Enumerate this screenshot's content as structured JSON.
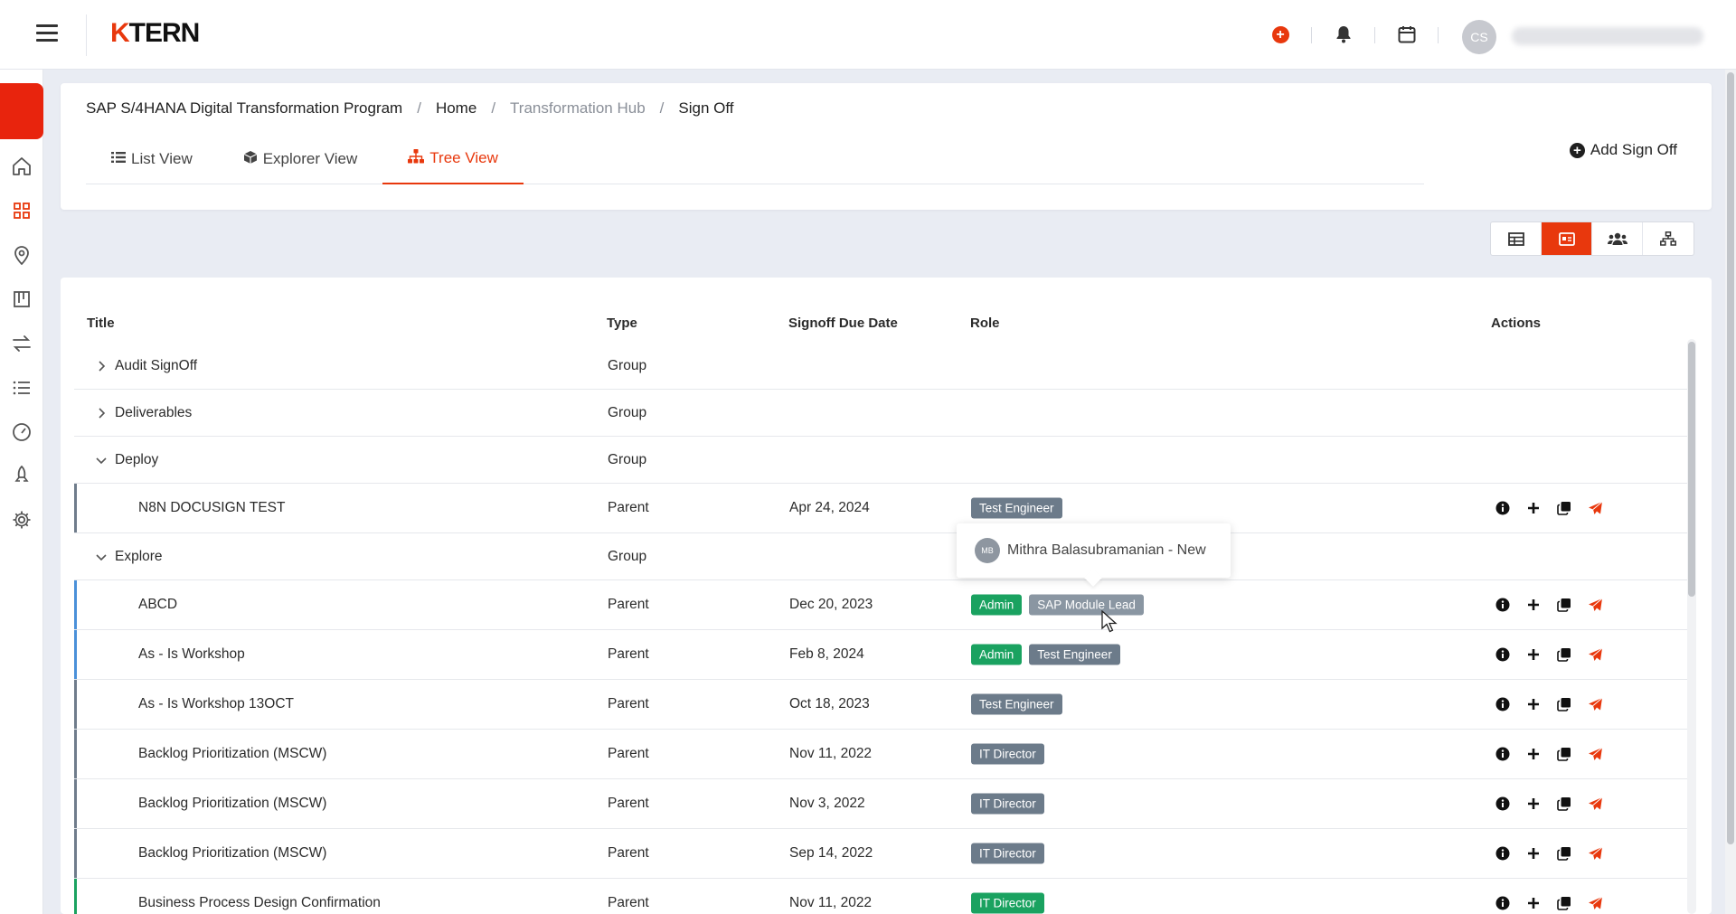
{
  "app": {
    "logo_k": "K",
    "logo_rest": "TERN"
  },
  "topbar": {
    "avatar_initials": "CS",
    "accent": "#e8380d"
  },
  "breadcrumb": [
    "SAP S/4HANA Digital Transformation Program",
    "Home",
    "Transformation Hub",
    "Sign Off"
  ],
  "tabs": [
    {
      "label": "List View",
      "icon": "list-icon"
    },
    {
      "label": "Explorer View",
      "icon": "box-icon"
    },
    {
      "label": "Tree View",
      "icon": "sitemap-icon",
      "active": true
    }
  ],
  "add_button": "Add Sign Off",
  "view_toggle": [
    "table-icon",
    "card-icon",
    "users-icon",
    "sitemap-icon"
  ],
  "table": {
    "headers": {
      "title": "Title",
      "type": "Type",
      "due": "Signoff Due Date",
      "role": "Role",
      "actions": "Actions"
    },
    "rows": [
      {
        "kind": "group",
        "title": "Audit SignOff",
        "type": "Group",
        "expanded": false
      },
      {
        "kind": "group",
        "title": "Deliverables",
        "type": "Group",
        "expanded": false
      },
      {
        "kind": "group",
        "title": "Deploy",
        "type": "Group",
        "expanded": true
      },
      {
        "kind": "item",
        "title": "N8N DOCUSIGN TEST",
        "type": "Parent",
        "due": "Apr 24, 2024",
        "bar": "#6f7c8b",
        "roles": [
          {
            "label": "Test Engineer",
            "color": "#6c7b8a"
          }
        ]
      },
      {
        "kind": "group",
        "title": "Explore",
        "type": "Group",
        "expanded": true
      },
      {
        "kind": "item",
        "title": "ABCD",
        "type": "Parent",
        "due": "Dec 20, 2023",
        "bar": "#4a90d9",
        "roles": [
          {
            "label": "Admin",
            "color": "#1aa260"
          },
          {
            "label": "SAP Module Lead",
            "color": "#8a96a2"
          }
        ]
      },
      {
        "kind": "item",
        "title": "As - Is Workshop",
        "type": "Parent",
        "due": "Feb 8, 2024",
        "bar": "#4a90d9",
        "roles": [
          {
            "label": "Admin",
            "color": "#1aa260"
          },
          {
            "label": "Test Engineer",
            "color": "#6c7b8a"
          }
        ]
      },
      {
        "kind": "item",
        "title": "As - Is Workshop 13OCT",
        "type": "Parent",
        "due": "Oct 18, 2023",
        "bar": "#6f7c8b",
        "roles": [
          {
            "label": "Test Engineer",
            "color": "#6c7b8a"
          }
        ]
      },
      {
        "kind": "item",
        "title": "Backlog Prioritization (MSCW)",
        "type": "Parent",
        "due": "Nov 11, 2022",
        "bar": "#6f7c8b",
        "roles": [
          {
            "label": "IT Director",
            "color": "#6c7b8a"
          }
        ]
      },
      {
        "kind": "item",
        "title": "Backlog Prioritization (MSCW)",
        "type": "Parent",
        "due": "Nov 3, 2022",
        "bar": "#6f7c8b",
        "roles": [
          {
            "label": "IT Director",
            "color": "#6c7b8a"
          }
        ]
      },
      {
        "kind": "item",
        "title": "Backlog Prioritization (MSCW)",
        "type": "Parent",
        "due": "Sep 14, 2022",
        "bar": "#6f7c8b",
        "roles": [
          {
            "label": "IT Director",
            "color": "#6c7b8a"
          }
        ]
      },
      {
        "kind": "item",
        "title": "Business Process Design Confirmation",
        "type": "Parent",
        "due": "Nov 11, 2022",
        "bar": "#1aa260",
        "roles": [
          {
            "label": "IT Director",
            "color": "#1aa260"
          }
        ]
      }
    ]
  },
  "tooltip": {
    "initials": "MB",
    "text": "Mithra Balasubramanian - New"
  }
}
